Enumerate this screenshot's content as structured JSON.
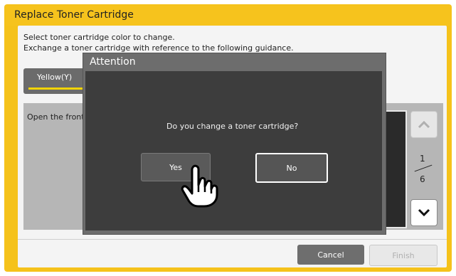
{
  "window": {
    "title": "Replace Toner Cartridge"
  },
  "instructions": {
    "line1": "Select toner cartridge color to change.",
    "line2": "Exchange a toner cartridge with reference to the following guidance."
  },
  "tabs": [
    {
      "label": "Yellow(Y)",
      "selected": true,
      "indicator_color": "#f3d400"
    }
  ],
  "panel": {
    "text": "Open the front cover."
  },
  "pager": {
    "current": "1",
    "total": "6",
    "up_icon": "chevron-up-icon",
    "down_icon": "chevron-down-icon"
  },
  "footer": {
    "cancel_label": "Cancel",
    "finish_label": "Finish"
  },
  "dialog": {
    "title": "Attention",
    "message": "Do you change a toner cartridge?",
    "yes_label": "Yes",
    "no_label": "No"
  },
  "colors": {
    "accent": "#f5c21b"
  }
}
